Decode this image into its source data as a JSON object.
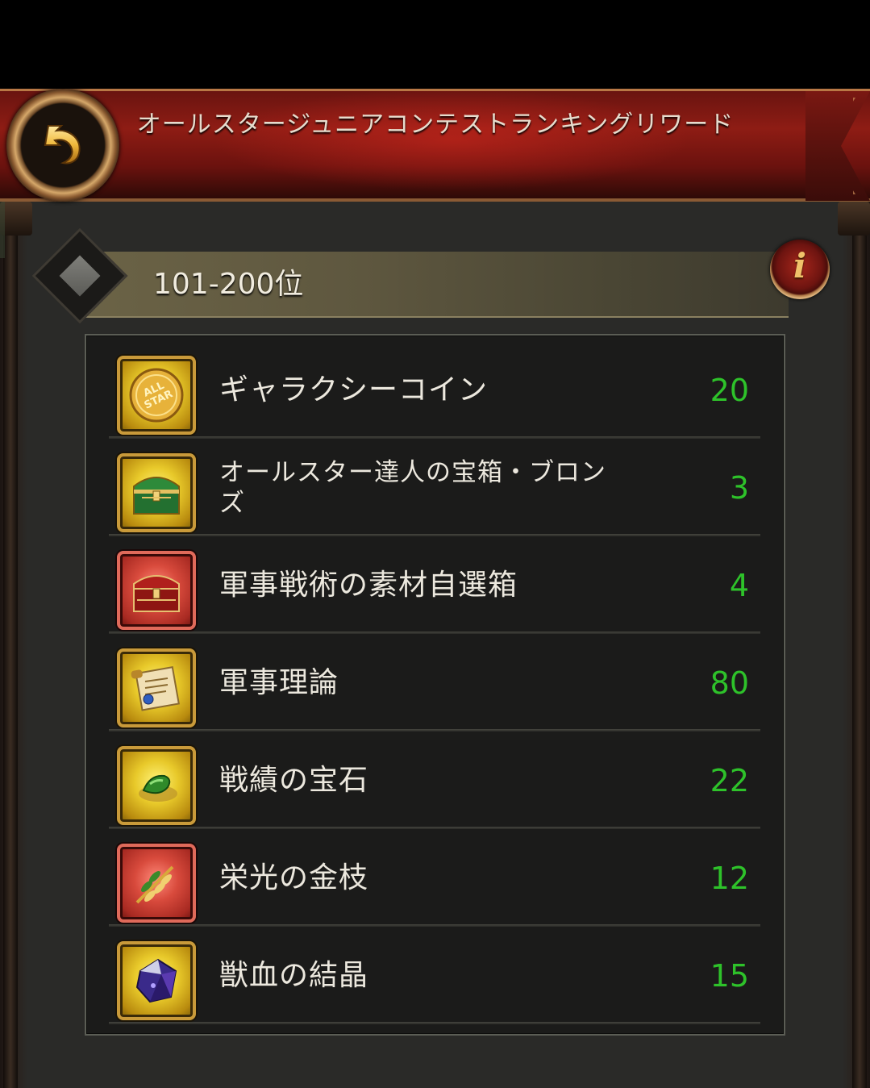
{
  "header": {
    "title": "オールスタージュニアコンテストランキングリワード"
  },
  "rank": {
    "label": "101-200位"
  },
  "info_button": {
    "glyph": "i"
  },
  "colors": {
    "quantity": "#2ec22a",
    "header_red": "#8e1c14",
    "gold_frame": "#c99a3a",
    "red_frame": "#e06a5a"
  },
  "rewards": [
    {
      "name": "ギャラクシーコイン",
      "quantity": "20",
      "icon": "all-star-coin-icon",
      "frame": "gold"
    },
    {
      "name": "オールスター達人の宝箱・ブロンズ",
      "quantity": "3",
      "icon": "green-treasure-chest-icon",
      "frame": "gold"
    },
    {
      "name": "軍事戦術の素材自選箱",
      "quantity": "4",
      "icon": "red-treasure-chest-icon",
      "frame": "red"
    },
    {
      "name": "軍事理論",
      "quantity": "80",
      "icon": "scroll-icon",
      "frame": "gold"
    },
    {
      "name": "戦績の宝石",
      "quantity": "22",
      "icon": "green-gem-icon",
      "frame": "gold"
    },
    {
      "name": "栄光の金枝",
      "quantity": "12",
      "icon": "golden-branch-icon",
      "frame": "red"
    },
    {
      "name": "獣血の結晶",
      "quantity": "15",
      "icon": "purple-crystal-icon",
      "frame": "gold"
    }
  ]
}
